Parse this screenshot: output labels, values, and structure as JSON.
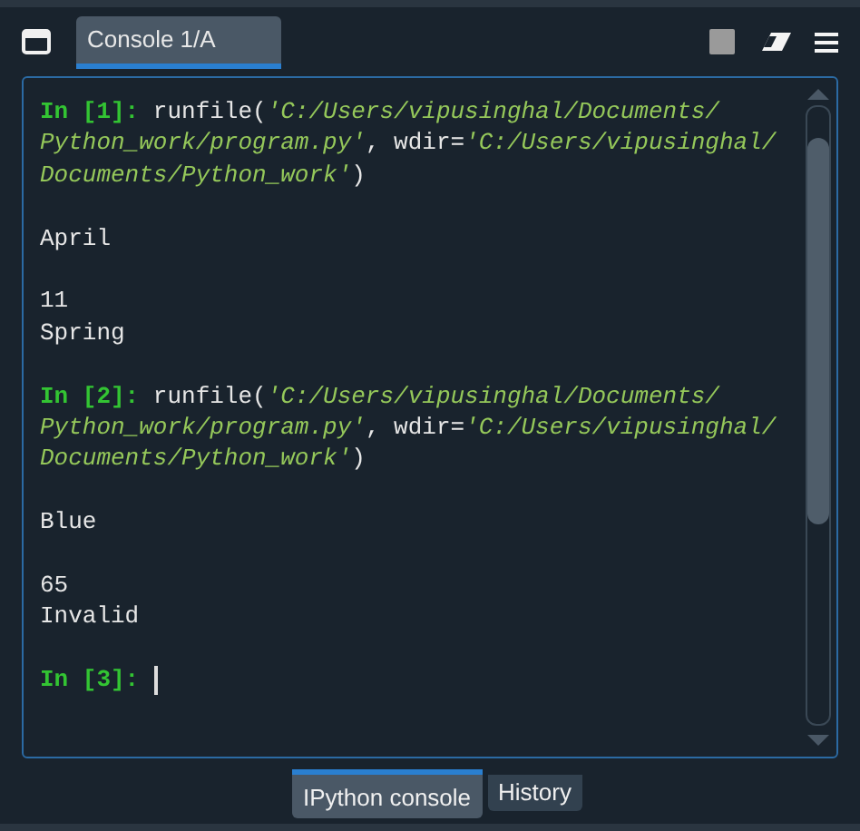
{
  "console_tabs": [
    {
      "label": "Console 1/A",
      "selected": true
    }
  ],
  "console": {
    "blocks": [
      [
        [
          {
            "kind": "prompt",
            "text": "In [1]:"
          },
          {
            "kind": "code",
            "text": " runfile("
          },
          {
            "kind": "string",
            "text": "'C:/Users/vipusinghal/Documents/"
          }
        ],
        [
          {
            "kind": "string",
            "text": "Python_work/program.py'"
          },
          {
            "kind": "code",
            "text": ", wdir="
          },
          {
            "kind": "string",
            "text": "'C:/Users/vipusinghal/"
          }
        ],
        [
          {
            "kind": "string",
            "text": "Documents/Python_work'"
          },
          {
            "kind": "code",
            "text": ")"
          }
        ]
      ],
      [
        [
          {
            "kind": "code",
            "text": "April"
          }
        ]
      ],
      [
        [
          {
            "kind": "code",
            "text": "11"
          }
        ],
        [
          {
            "kind": "code",
            "text": "Spring"
          }
        ]
      ],
      [
        [
          {
            "kind": "prompt",
            "text": "In [2]:"
          },
          {
            "kind": "code",
            "text": " runfile("
          },
          {
            "kind": "string",
            "text": "'C:/Users/vipusinghal/Documents/"
          }
        ],
        [
          {
            "kind": "string",
            "text": "Python_work/program.py'"
          },
          {
            "kind": "code",
            "text": ", wdir="
          },
          {
            "kind": "string",
            "text": "'C:/Users/vipusinghal/"
          }
        ],
        [
          {
            "kind": "string",
            "text": "Documents/Python_work'"
          },
          {
            "kind": "code",
            "text": ")"
          }
        ]
      ],
      [
        [
          {
            "kind": "code",
            "text": "Blue"
          }
        ]
      ],
      [
        [
          {
            "kind": "code",
            "text": "65"
          }
        ],
        [
          {
            "kind": "code",
            "text": "Invalid"
          }
        ]
      ],
      [
        [
          {
            "kind": "prompt",
            "text": "In [3]:"
          },
          {
            "kind": "cursor"
          }
        ]
      ]
    ]
  },
  "pane_tabs": [
    {
      "label": "IPython console",
      "selected": true
    },
    {
      "label": "History",
      "selected": false
    }
  ]
}
